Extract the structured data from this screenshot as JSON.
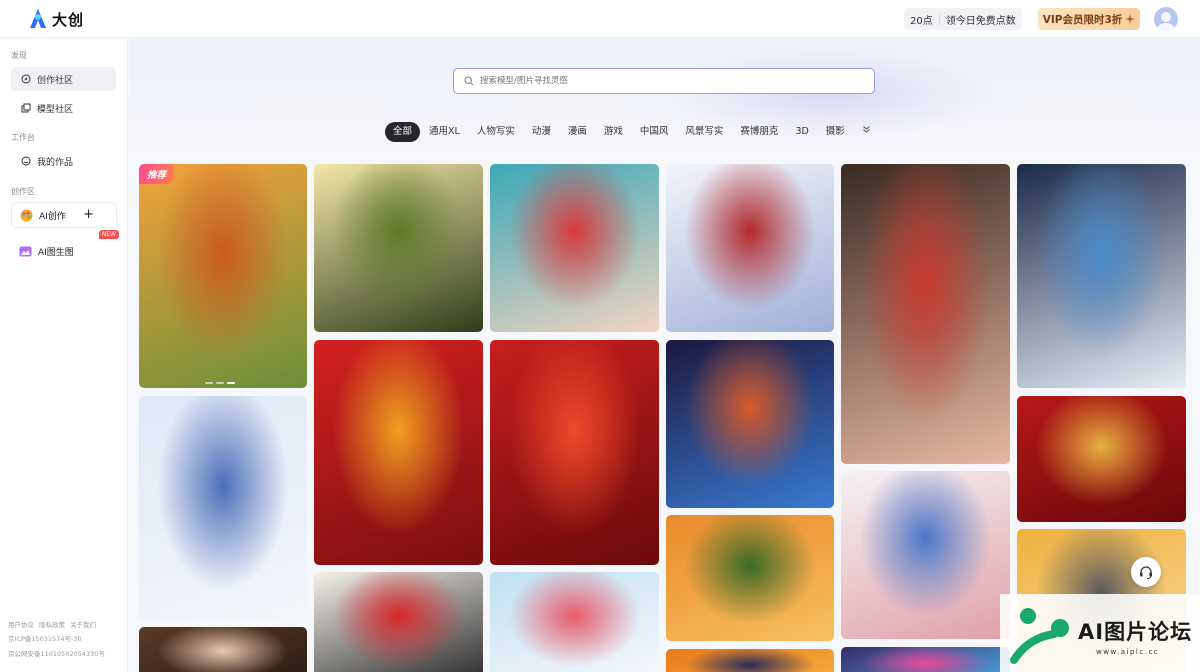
{
  "header": {
    "logo_text": "大创",
    "points_label": "20点",
    "free_points_label": "领今日免费点数",
    "vip_label": "VIP会员限时3折"
  },
  "sidebar": {
    "section_discover": "发现",
    "item_community": "创作社区",
    "item_models": "模型社区",
    "section_workbench": "工作台",
    "item_my_works": "我的作品",
    "section_create": "创作区",
    "item_ai_create": "AI创作",
    "item_img2img": "AI图生图",
    "new_badge": "NEW",
    "footer_links": [
      "用户协议",
      "隐私政策",
      "关于我们"
    ],
    "icp": "京ICP备15031574号-30",
    "police": "京公网安备11010502054330号"
  },
  "search": {
    "placeholder": "搜索模型/图片寻找灵感"
  },
  "tabs": [
    "全部",
    "通用XL",
    "人物写实",
    "动漫",
    "漫画",
    "游戏",
    "中国风",
    "风景写实",
    "赛博朋克",
    "3D",
    "摄影"
  ],
  "active_tab": "全部",
  "feed": {
    "recommend_badge": "推荐",
    "cards": [
      {
        "name": "cartoon-rabbit",
        "colors": [
          "#f4a23a",
          "#c95b22",
          "#6b8f3a"
        ]
      },
      {
        "name": "tree-lined-path",
        "colors": [
          "#f3e7a8",
          "#5f7a2c",
          "#2f3d1a"
        ]
      },
      {
        "name": "anime-teal-hair-girl",
        "colors": [
          "#3aa8b8",
          "#d93b3b",
          "#f2d4c0"
        ]
      },
      {
        "name": "white-hair-cat-girl",
        "colors": [
          "#f4f4fa",
          "#b32a2a",
          "#9fb0d8"
        ]
      },
      {
        "name": "chinese-woman-portrait",
        "colors": [
          "#3a2a22",
          "#c83a2e",
          "#e8b8a0"
        ]
      },
      {
        "name": "blue-sugar-skull",
        "colors": [
          "#1a2a48",
          "#4b8ac8",
          "#e8eef8"
        ]
      },
      {
        "name": "blue-hair-anime-girl",
        "colors": [
          "#dfe8f6",
          "#4a6fb8",
          "#f4f6fb"
        ]
      },
      {
        "name": "lion-dance-new-year",
        "colors": [
          "#d42020",
          "#f0a020",
          "#7a0f0f"
        ]
      },
      {
        "name": "red-dragon-gate",
        "colors": [
          "#c81e1e",
          "#f04a2a",
          "#6a0a0a"
        ]
      },
      {
        "name": "fireworks-pagoda",
        "colors": [
          "#1a1840",
          "#d85a2a",
          "#3a7ad0"
        ]
      },
      {
        "name": "red-gold-dragon",
        "colors": [
          "#b81818",
          "#e8b040",
          "#6a0808"
        ]
      },
      {
        "name": "fox-dog-sunset",
        "colors": [
          "#e88a2a",
          "#3a6a28",
          "#f8c060"
        ]
      },
      {
        "name": "white-cat-girl-flowers",
        "colors": [
          "#f6f2f4",
          "#4a78c8",
          "#e0a0a8"
        ]
      },
      {
        "name": "husky-dog-moon",
        "colors": [
          "#f0b040",
          "#5a5a5a",
          "#fae0a0"
        ]
      },
      {
        "name": "ink-painting-sun",
        "colors": [
          "#f4f0ea",
          "#d8282a",
          "#2a2a2a"
        ]
      },
      {
        "name": "white-dragon-blue",
        "colors": [
          "#bfe0f2",
          "#e85a6a",
          "#f8f8fb"
        ]
      },
      {
        "name": "woman-portrait-bottom",
        "colors": [
          "#5a3a28",
          "#e8c8b0",
          "#2a1a10"
        ]
      },
      {
        "name": "orange-bottom-card",
        "colors": [
          "#e87a1a",
          "#2a2a5a",
          "#f8b040"
        ]
      },
      {
        "name": "neon-bottom-card",
        "colors": [
          "#3a2a6a",
          "#e84a9a",
          "#4ab0e8"
        ]
      }
    ]
  },
  "watermark": {
    "title": "AI图片论坛",
    "url": "www.aiplc.cc"
  }
}
